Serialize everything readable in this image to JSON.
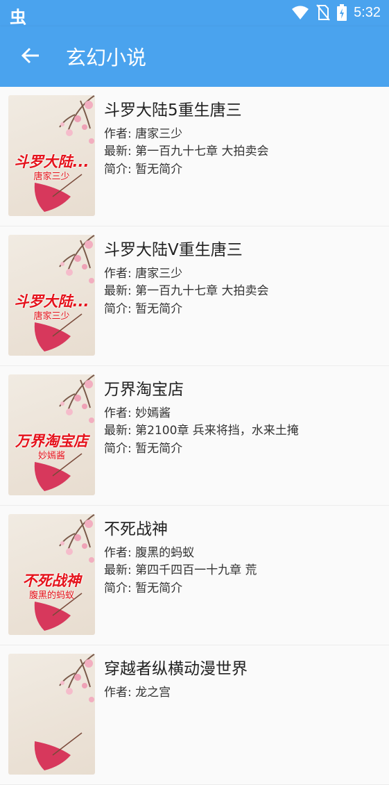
{
  "status_bar": {
    "logo": "虫",
    "time": "5:32",
    "icons": [
      "wifi-icon",
      "no-sim-icon",
      "battery-charging-icon"
    ]
  },
  "app_bar": {
    "title": "玄幻小说",
    "back_icon": "arrow-left-icon"
  },
  "labels": {
    "author": "作者: ",
    "latest": "最新: ",
    "intro": "简介: "
  },
  "books": [
    {
      "title": "斗罗大陆5重生唐三",
      "cover_title": "斗罗大陆...",
      "cover_author": "唐家三少",
      "author": "唐家三少",
      "latest": "第一百九十七章 大拍卖会",
      "intro": "暂无简介"
    },
    {
      "title": "斗罗大陆V重生唐三",
      "cover_title": "斗罗大陆...",
      "cover_author": "唐家三少",
      "author": "唐家三少",
      "latest": "第一百九十七章 大拍卖会",
      "intro": "暂无简介"
    },
    {
      "title": "万界淘宝店",
      "cover_title": "万界淘宝店",
      "cover_author": "妙嫣酱",
      "author": "妙嫣酱",
      "latest": "第2100章 兵来将挡，水来土掩",
      "intro": "暂无简介"
    },
    {
      "title": "不死战神",
      "cover_title": "不死战神",
      "cover_author": "腹黑的蚂蚁",
      "author": "腹黑的蚂蚁",
      "latest": "第四千四百一十九章 荒",
      "intro": "暂无简介"
    },
    {
      "title": "穿越者纵横动漫世界",
      "cover_title": "",
      "cover_author": "",
      "author": "龙之宫",
      "latest": "",
      "intro": ""
    }
  ],
  "colors": {
    "primary": "#4aa3ee",
    "cover_text": "#e5121b",
    "background": "#fafafa"
  }
}
